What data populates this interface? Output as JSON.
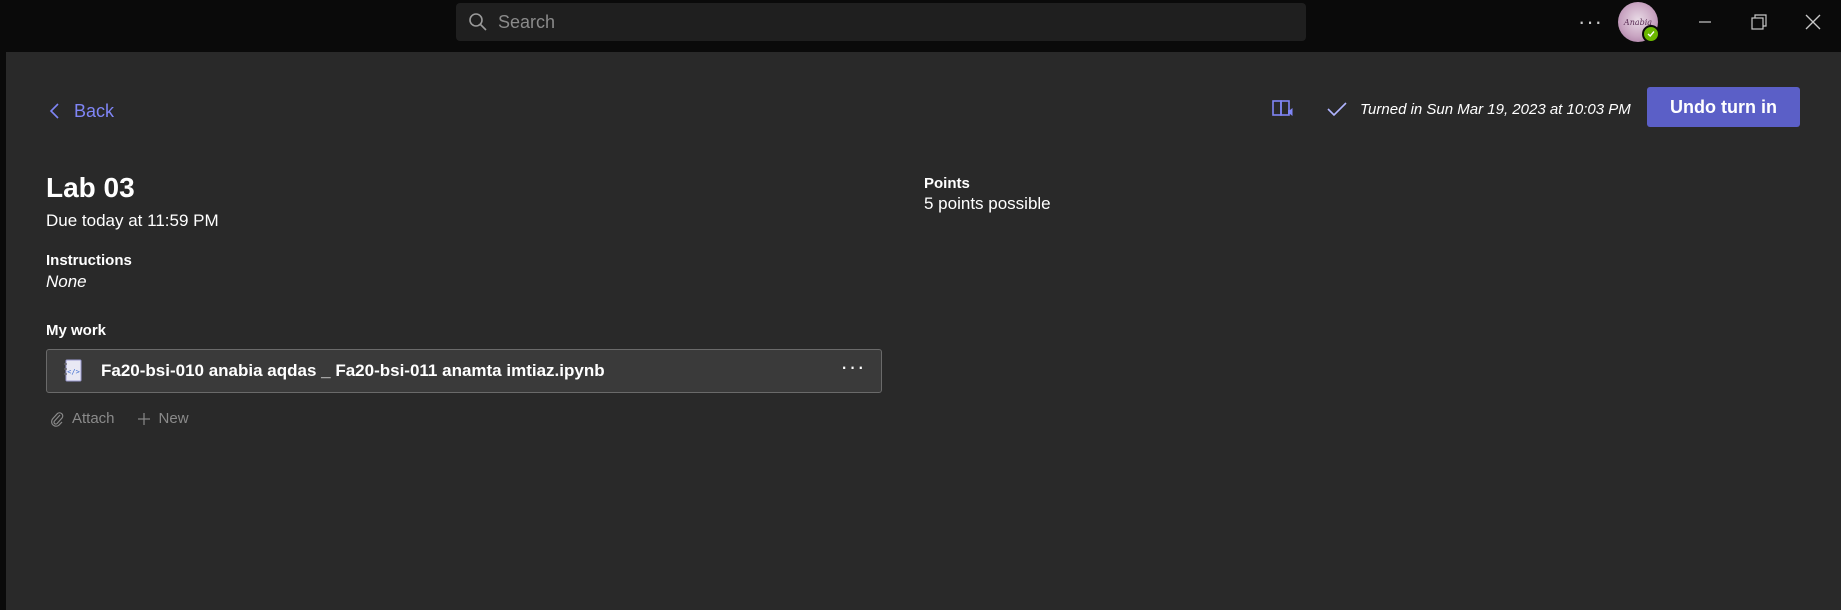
{
  "titlebar": {
    "search_placeholder": "Search",
    "more_label": "···",
    "avatar_signature": "Anabia"
  },
  "header": {
    "back_label": "Back",
    "turned_in_text": "Turned in Sun Mar 19, 2023 at 10:03 PM",
    "undo_label": "Undo turn in"
  },
  "assignment": {
    "title": "Lab 03",
    "due": "Due today at 11:59 PM",
    "instructions_label": "Instructions",
    "instructions_value": "None",
    "points_label": "Points",
    "points_value": "5 points possible",
    "my_work_label": "My work"
  },
  "file": {
    "name": "Fa20-bsi-010 anabia aqdas _ Fa20-bsi-011 anamta imtiaz.ipynb",
    "more_label": "···"
  },
  "actions": {
    "attach_label": "Attach",
    "new_label": "New"
  },
  "colors": {
    "accent": "#5b5fc7",
    "link": "#7f85f5",
    "background": "#292929",
    "titlebar": "#0a0a0a",
    "presence": "#6bb700"
  },
  "icons": [
    "search-icon",
    "more-icon",
    "minimize-icon",
    "restore-icon",
    "close-icon",
    "chevron-left-icon",
    "immersive-reader-icon",
    "checkmark-icon",
    "notebook-file-icon",
    "paperclip-icon",
    "plus-icon"
  ]
}
